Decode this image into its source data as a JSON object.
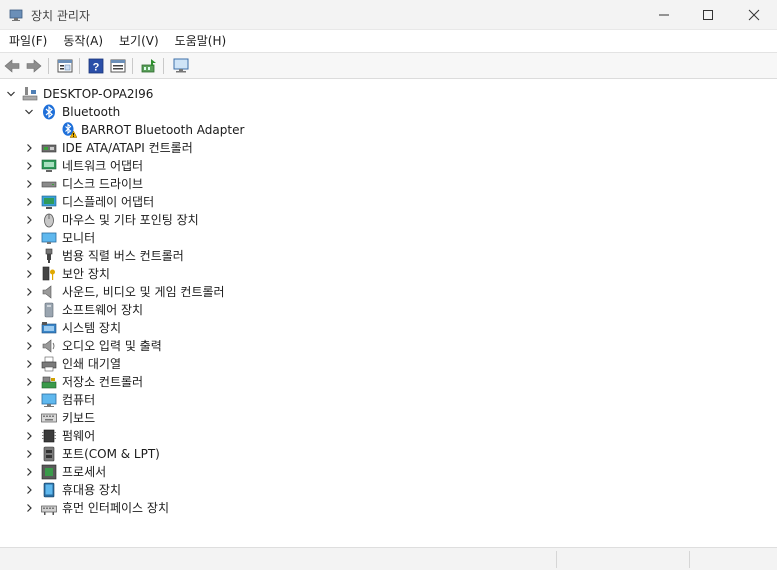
{
  "window": {
    "title": "장치 관리자",
    "icon": "device-manager-icon"
  },
  "menu": [
    "파일(F)",
    "동작(A)",
    "보기(V)",
    "도움말(H)"
  ],
  "toolbar": {
    "buttons": [
      "back-arrow-icon",
      "forward-arrow-icon",
      "properties-pane-icon",
      "help-icon",
      "view-pane-icon",
      "update-driver-icon",
      "scan-hardware-icon"
    ]
  },
  "tree": {
    "root": "DESKTOP-OPA2I96",
    "bluetooth": {
      "label": "Bluetooth",
      "child": "BARROT Bluetooth Adapter"
    },
    "categories": [
      "IDE ATA/ATAPI 컨트롤러",
      "네트워크 어댑터",
      "디스크 드라이브",
      "디스플레이 어댑터",
      "마우스 및 기타 포인팅 장치",
      "모니터",
      "범용 직렬 버스 컨트롤러",
      "보안 장치",
      "사운드, 비디오 및 게임 컨트롤러",
      "소프트웨어 장치",
      "시스템 장치",
      "오디오 입력 및 출력",
      "인쇄 대기열",
      "저장소 컨트롤러",
      "컴퓨터",
      "키보드",
      "펌웨어",
      "포트(COM & LPT)",
      "프로세서",
      "휴대용 장치",
      "휴먼 인터페이스 장치"
    ]
  },
  "colors": {
    "accent": "#1e6fd9",
    "warning": "#f2b600"
  }
}
